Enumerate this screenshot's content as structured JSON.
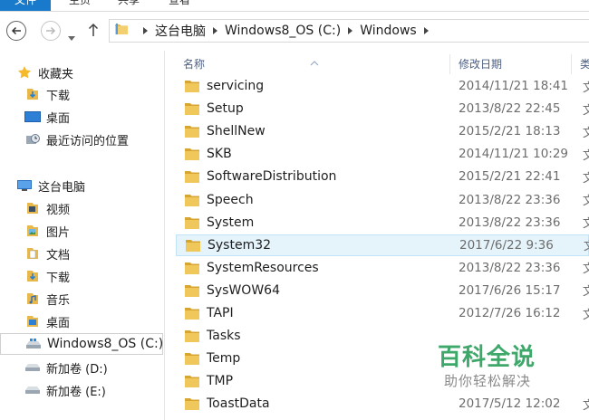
{
  "ribbon": {
    "file_label": "文件",
    "tabs": [
      "主页",
      "共享",
      "查看"
    ]
  },
  "address": {
    "crumbs": [
      "这台电脑",
      "Windows8_OS (C:)",
      "Windows"
    ]
  },
  "sidebar": {
    "favorites_label": "收藏夹",
    "favorites": [
      "下载",
      "桌面",
      "最近访问的位置"
    ],
    "thispc_label": "这台电脑",
    "thispc_items": [
      "视频",
      "图片",
      "文档",
      "下载",
      "音乐",
      "桌面"
    ],
    "drives": [
      "Windows8_OS (C:)",
      "新加卷 (D:)",
      "新加卷 (E:)"
    ]
  },
  "content": {
    "columns": [
      "名称",
      "修改日期",
      "类"
    ],
    "rows": [
      {
        "name": "servicing",
        "date": "2014/11/21 18:41",
        "type": "文"
      },
      {
        "name": "Setup",
        "date": "2013/8/22 22:45",
        "type": "文"
      },
      {
        "name": "ShellNew",
        "date": "2015/2/21 18:13",
        "type": "文"
      },
      {
        "name": "SKB",
        "date": "2014/11/21 10:29",
        "type": "文"
      },
      {
        "name": "SoftwareDistribution",
        "date": "2015/2/21 22:41",
        "type": "文"
      },
      {
        "name": "Speech",
        "date": "2013/8/22 23:36",
        "type": "文"
      },
      {
        "name": "System",
        "date": "2013/8/22 23:36",
        "type": "文"
      },
      {
        "name": "System32",
        "date": "2017/6/22 9:36",
        "type": "文"
      },
      {
        "name": "SystemResources",
        "date": "2013/8/22 23:36",
        "type": "文"
      },
      {
        "name": "SysWOW64",
        "date": "2017/6/26 15:17",
        "type": "文"
      },
      {
        "name": "TAPI",
        "date": "2012/7/26 16:12",
        "type": "文"
      },
      {
        "name": "Tasks",
        "date": "",
        "type": ""
      },
      {
        "name": "Temp",
        "date": "",
        "type": ""
      },
      {
        "name": "TMP",
        "date": "",
        "type": ""
      },
      {
        "name": "ToastData",
        "date": "2017/5/12 12:02",
        "type": "文"
      }
    ]
  },
  "watermark": {
    "title": "百科全说",
    "subtitle": "助你轻松解决"
  },
  "colors": {
    "accent": "#1979ca",
    "folder": "#e8b84a",
    "selection": "#e5f3fb",
    "watermark": "#3ea86b"
  }
}
